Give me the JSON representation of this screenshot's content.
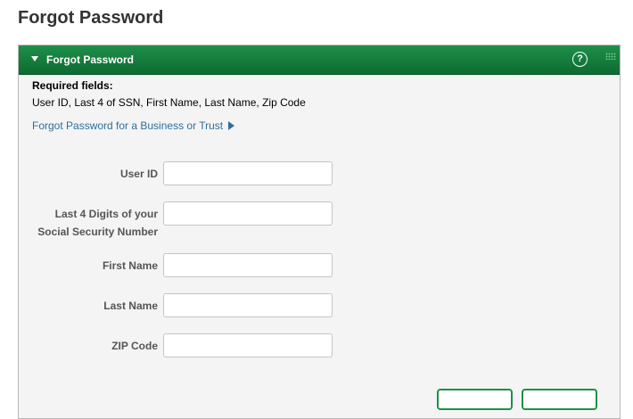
{
  "page": {
    "title": "Forgot Password"
  },
  "panel": {
    "title": "Forgot Password",
    "help_symbol": "?",
    "icons": {
      "collapse": "triangle-down-icon",
      "help": "question-circle-icon",
      "grip": "grip-dots-icon"
    },
    "header_color": "#1f8f4a"
  },
  "required": {
    "heading": "Required fields:",
    "list": "User ID, Last 4 of SSN, First Name, Last Name, Zip Code"
  },
  "business_link": {
    "label": "Forgot Password for a Business or Trust",
    "color": "#2e6e9e"
  },
  "form": {
    "user_id": {
      "label": "User ID",
      "value": ""
    },
    "ssn_last4": {
      "label_line1": "Last 4 Digits of your",
      "label_line2": "Social Security Number",
      "value": ""
    },
    "first_name": {
      "label": "First Name",
      "value": ""
    },
    "last_name": {
      "label": "Last Name",
      "value": ""
    },
    "zip_code": {
      "label": "ZIP Code",
      "value": ""
    }
  }
}
